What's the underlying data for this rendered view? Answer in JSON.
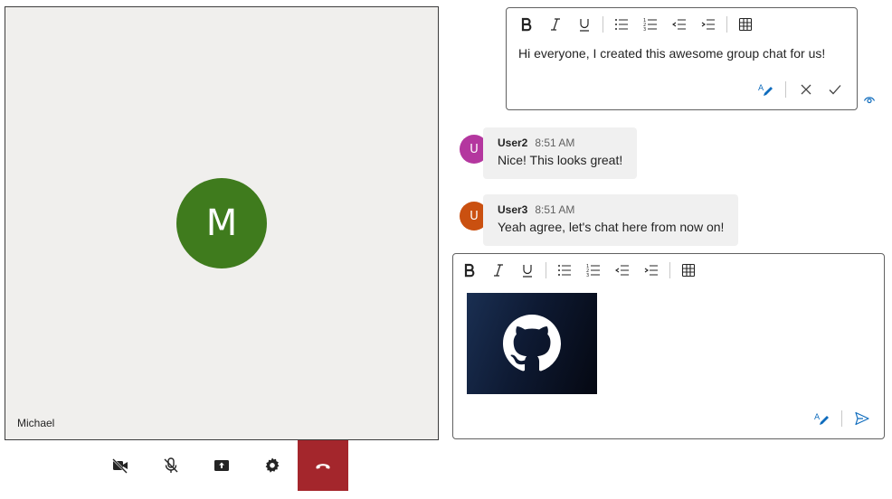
{
  "participant": {
    "initial": "M",
    "name": "Michael",
    "avatar_color": "#3f7b1d"
  },
  "call_controls": [
    {
      "name": "camera-off",
      "icon": "video-off-icon"
    },
    {
      "name": "mic-off",
      "icon": "mic-off-icon"
    },
    {
      "name": "share-screen",
      "icon": "share-screen-icon"
    },
    {
      "name": "settings",
      "icon": "gear-icon"
    },
    {
      "name": "hang-up",
      "icon": "phone-hangup-icon",
      "color": "#a4262c"
    }
  ],
  "edit_box": {
    "text": "Hi everyone, I created this awesome group chat for us!"
  },
  "messages": [
    {
      "avatar_initial": "U",
      "avatar_color": "#b4379f",
      "sender": "User2",
      "time": "8:51 AM",
      "text": "Nice! This looks great!"
    },
    {
      "avatar_initial": "U",
      "avatar_color": "#ca5010",
      "sender": "User3",
      "time": "8:51 AM",
      "text": "Yeah agree, let's chat here from now on!"
    }
  ],
  "compose": {
    "attachment": "github-logo-image"
  },
  "colors": {
    "accent": "#0f6cbd",
    "hangup": "#a4262c",
    "bubble": "#f0f0f0"
  }
}
